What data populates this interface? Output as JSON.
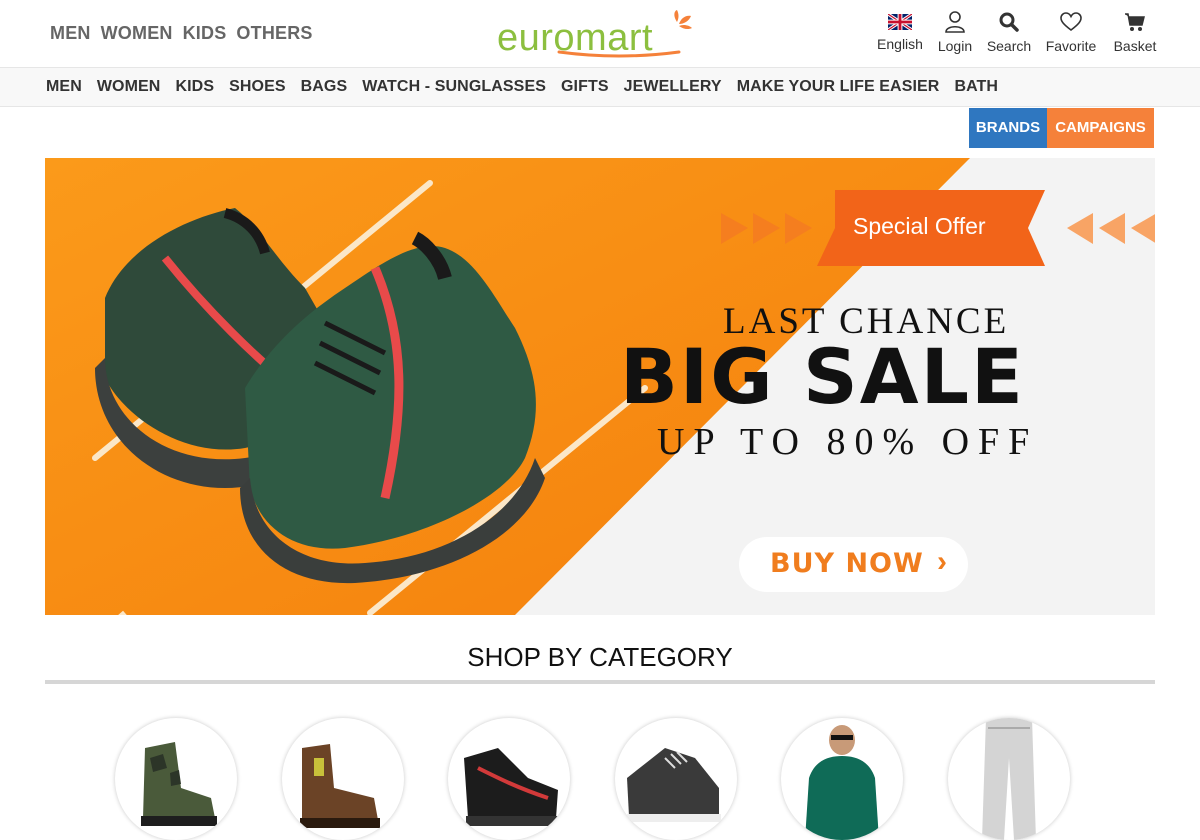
{
  "header": {
    "gender_nav": [
      "MEN",
      "WOMEN",
      "KIDS",
      "OTHERS"
    ],
    "logo_text": "euromart",
    "tools": {
      "language": "English",
      "login": "Login",
      "search": "Search",
      "favorite": "Favorite",
      "basket": "Basket"
    }
  },
  "category_nav": [
    "MEN",
    "WOMEN",
    "KIDS",
    "SHOES",
    "BAGS",
    "WATCH - SUNGLASSES",
    "GIFTS",
    "JEWELLERY",
    "MAKE YOUR LIFE EASIER",
    "BATH"
  ],
  "promo_buttons": {
    "brands": "BRANDS",
    "campaigns": "CAMPAIGNS"
  },
  "banner": {
    "special_offer": "Special Offer",
    "last_chance": "LAST CHANCE",
    "big_sale": "BIG SALE",
    "discount": "UP TO 80% OFF",
    "cta": "BUY NOW"
  },
  "shop_by_category": {
    "title": "SHOP BY CATEGORY",
    "items": [
      {
        "icon": "camo-boot-icon"
      },
      {
        "icon": "brown-boot-icon"
      },
      {
        "icon": "sneaker-icon"
      },
      {
        "icon": "casual-shoe-icon"
      },
      {
        "icon": "sweater-model-icon"
      },
      {
        "icon": "trousers-icon"
      }
    ]
  },
  "colors": {
    "logo_green": "#8cbf3f",
    "logo_orange": "#f5813a",
    "brands_blue": "#2f77c0",
    "campaigns_orange": "#f5813a",
    "banner_orange": "#f7860f"
  }
}
